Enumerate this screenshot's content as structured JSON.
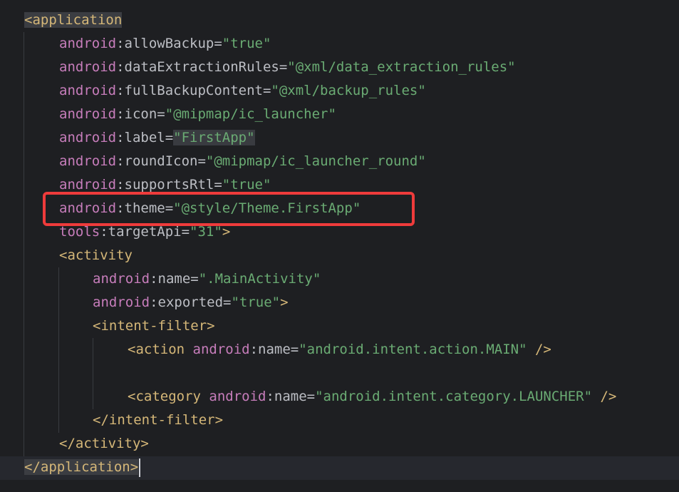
{
  "editor": {
    "highlighted_attribute": "android:theme=\"@style/Theme.FirstApp\"",
    "lines": [
      {
        "indent": 0,
        "tokens": [
          {
            "t": "<application",
            "c": "tag hl-tag"
          }
        ]
      },
      {
        "indent": 1,
        "tokens": [
          {
            "t": "android",
            "c": "ns"
          },
          {
            "t": ":allowBackup=",
            "c": "attr"
          },
          {
            "t": "\"true\"",
            "c": "str"
          }
        ]
      },
      {
        "indent": 1,
        "tokens": [
          {
            "t": "android",
            "c": "ns"
          },
          {
            "t": ":dataExtractionRules=",
            "c": "attr"
          },
          {
            "t": "\"@xml/data_extraction_rules\"",
            "c": "str"
          }
        ]
      },
      {
        "indent": 1,
        "tokens": [
          {
            "t": "android",
            "c": "ns"
          },
          {
            "t": ":fullBackupContent=",
            "c": "attr"
          },
          {
            "t": "\"@xml/backup_rules\"",
            "c": "str"
          }
        ]
      },
      {
        "indent": 1,
        "tokens": [
          {
            "t": "android",
            "c": "ns"
          },
          {
            "t": ":icon=",
            "c": "attr"
          },
          {
            "t": "\"@mipmap/ic_launcher\"",
            "c": "str"
          }
        ]
      },
      {
        "indent": 1,
        "tokens": [
          {
            "t": "android",
            "c": "ns"
          },
          {
            "t": ":label=",
            "c": "attr"
          },
          {
            "t": "\"FirstApp\"",
            "c": "str hl-word"
          }
        ]
      },
      {
        "indent": 1,
        "tokens": [
          {
            "t": "android",
            "c": "ns"
          },
          {
            "t": ":roundIcon=",
            "c": "attr"
          },
          {
            "t": "\"@mipmap/ic_launcher_round\"",
            "c": "str"
          }
        ]
      },
      {
        "indent": 1,
        "tokens": [
          {
            "t": "android",
            "c": "ns"
          },
          {
            "t": ":supportsRtl=",
            "c": "attr"
          },
          {
            "t": "\"true\"",
            "c": "str"
          }
        ]
      },
      {
        "indent": 1,
        "tokens": [
          {
            "t": "android",
            "c": "ns"
          },
          {
            "t": ":theme=",
            "c": "attr"
          },
          {
            "t": "\"@style/Theme.FirstApp\"",
            "c": "str"
          }
        ]
      },
      {
        "indent": 1,
        "tokens": [
          {
            "t": "tools",
            "c": "ns"
          },
          {
            "t": ":targetApi=",
            "c": "attr"
          },
          {
            "t": "\"31\"",
            "c": "str"
          },
          {
            "t": ">",
            "c": "tag"
          }
        ]
      },
      {
        "indent": 1,
        "tokens": [
          {
            "t": "<activity",
            "c": "tag"
          }
        ]
      },
      {
        "indent": 2,
        "tokens": [
          {
            "t": "android",
            "c": "ns"
          },
          {
            "t": ":name=",
            "c": "attr"
          },
          {
            "t": "\".MainActivity\"",
            "c": "str"
          }
        ]
      },
      {
        "indent": 2,
        "tokens": [
          {
            "t": "android",
            "c": "ns"
          },
          {
            "t": ":exported=",
            "c": "attr"
          },
          {
            "t": "\"true\"",
            "c": "str"
          },
          {
            "t": ">",
            "c": "tag"
          }
        ]
      },
      {
        "indent": 2,
        "tokens": [
          {
            "t": "<intent-filter>",
            "c": "tag"
          }
        ]
      },
      {
        "indent": 3,
        "tokens": [
          {
            "t": "<action ",
            "c": "tag"
          },
          {
            "t": "android",
            "c": "ns"
          },
          {
            "t": ":name=",
            "c": "attr"
          },
          {
            "t": "\"android.intent.action.MAIN\"",
            "c": "str"
          },
          {
            "t": " />",
            "c": "tag"
          }
        ]
      },
      {
        "indent": 0,
        "tokens": []
      },
      {
        "indent": 3,
        "tokens": [
          {
            "t": "<category ",
            "c": "tag"
          },
          {
            "t": "android",
            "c": "ns"
          },
          {
            "t": ":name=",
            "c": "attr"
          },
          {
            "t": "\"android.intent.category.LAUNCHER\"",
            "c": "str"
          },
          {
            "t": " />",
            "c": "tag"
          }
        ]
      },
      {
        "indent": 2,
        "tokens": [
          {
            "t": "</intent-filter>",
            "c": "tag"
          }
        ]
      },
      {
        "indent": 1,
        "tokens": [
          {
            "t": "</activity>",
            "c": "tag"
          }
        ]
      },
      {
        "indent": 0,
        "tokens": [
          {
            "t": "</application>",
            "c": "tag hl-tag"
          }
        ],
        "caret": true
      }
    ]
  },
  "colors": {
    "background": "#1e1f22",
    "tag": "#d5b778",
    "namespace": "#c77dbb",
    "attribute": "#bcbec4",
    "string": "#6aab73",
    "highlight_box": "#ef3b3b"
  }
}
